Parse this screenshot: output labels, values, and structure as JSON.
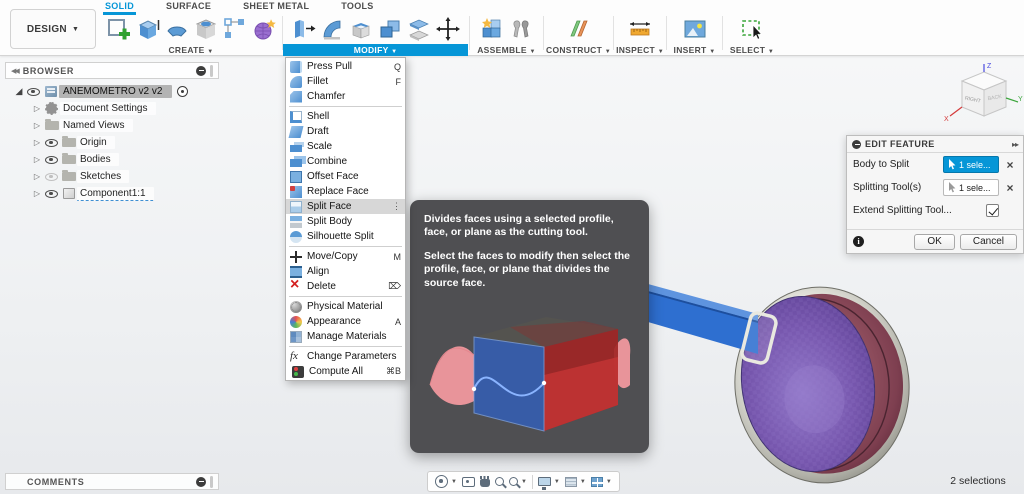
{
  "colors": {
    "accent": "#0696d7",
    "tooltip_bg": "#48484b",
    "selection_purple": "#7757ae",
    "arm_blue": "#2e6fd0",
    "cup_maroon": "#8e4f5e"
  },
  "toolbar": {
    "design_label": "DESIGN",
    "tabs": [
      {
        "label": "SOLID"
      },
      {
        "label": "SURFACE"
      },
      {
        "label": "SHEET METAL"
      },
      {
        "label": "TOOLS"
      }
    ],
    "groups": {
      "create": "CREATE",
      "modify": "MODIFY",
      "assemble": "ASSEMBLE",
      "construct": "CONSTRUCT",
      "inspect": "INSPECT",
      "insert": "INSERT",
      "select": "SELECT"
    }
  },
  "browser": {
    "title": "BROWSER",
    "root_label": "ANEMOMETRO v2 v2",
    "items": [
      {
        "label": "Document Settings"
      },
      {
        "label": "Named Views"
      },
      {
        "label": "Origin"
      },
      {
        "label": "Bodies"
      },
      {
        "label": "Sketches"
      },
      {
        "label": "Component1:1"
      }
    ]
  },
  "modify_menu": {
    "items": [
      {
        "label": "Press Pull",
        "shortcut": "Q"
      },
      {
        "label": "Fillet",
        "shortcut": "F"
      },
      {
        "label": "Chamfer",
        "shortcut": ""
      },
      {
        "label": "Shell",
        "shortcut": ""
      },
      {
        "label": "Draft",
        "shortcut": ""
      },
      {
        "label": "Scale",
        "shortcut": ""
      },
      {
        "label": "Combine",
        "shortcut": ""
      },
      {
        "label": "Offset Face",
        "shortcut": ""
      },
      {
        "label": "Replace Face",
        "shortcut": ""
      },
      {
        "label": "Split Face",
        "shortcut": ""
      },
      {
        "label": "Split Body",
        "shortcut": ""
      },
      {
        "label": "Silhouette Split",
        "shortcut": ""
      },
      {
        "label": "Move/Copy",
        "shortcut": "M"
      },
      {
        "label": "Align",
        "shortcut": ""
      },
      {
        "label": "Delete",
        "shortcut": "⌦"
      },
      {
        "label": "Physical Material",
        "shortcut": ""
      },
      {
        "label": "Appearance",
        "shortcut": "A"
      },
      {
        "label": "Manage Materials",
        "shortcut": ""
      },
      {
        "label": "Change Parameters",
        "shortcut": ""
      },
      {
        "label": "Compute All",
        "shortcut": "⌘B"
      }
    ]
  },
  "tooltip": {
    "line1": "Divides faces using a selected profile, face, or plane as the cutting tool.",
    "line2": "Select the faces to modify then select the profile, face, or plane that divides the source face."
  },
  "edit_feature": {
    "title": "EDIT FEATURE",
    "body_to_split_label": "Body to Split",
    "body_to_split_value": "1 sele...",
    "splitting_tools_label": "Splitting Tool(s)",
    "splitting_tools_value": "1 sele...",
    "extend_label": "Extend Splitting Tool...",
    "ok_label": "OK",
    "cancel_label": "Cancel"
  },
  "viewcube": {
    "right_face": "RIGHT",
    "back_face": "BACK",
    "axis_x": "X",
    "axis_y": "Y",
    "axis_z": "Z"
  },
  "statusbar": {
    "comments_title": "COMMENTS",
    "selections": "2 selections"
  }
}
